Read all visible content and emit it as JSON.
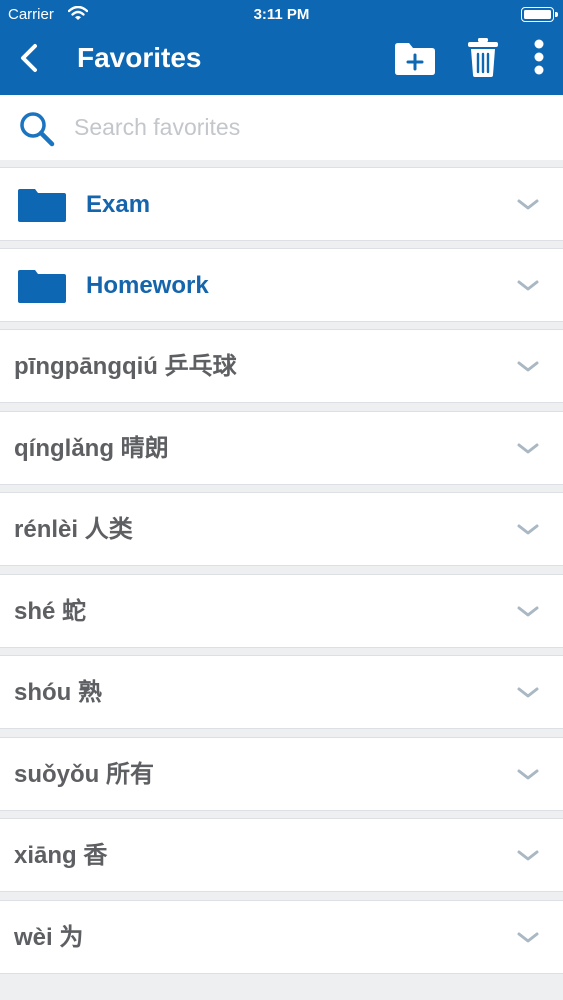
{
  "status_bar": {
    "carrier": "Carrier",
    "time": "3:11 PM"
  },
  "header": {
    "title": "Favorites"
  },
  "search": {
    "placeholder": "Search favorites"
  },
  "folders": [
    {
      "label": "Exam"
    },
    {
      "label": "Homework"
    }
  ],
  "words": [
    {
      "label": "pīngpāngqiú 乒乓球"
    },
    {
      "label": "qínglǎng 晴朗"
    },
    {
      "label": "rénlèi 人类"
    },
    {
      "label": "shé 蛇"
    },
    {
      "label": "shóu 熟"
    },
    {
      "label": "suǒyǒu 所有"
    },
    {
      "label": "xiāng 香"
    },
    {
      "label": "wèi 为"
    }
  ],
  "colors": {
    "header": "#0d67b2",
    "folder_text": "#1565ad",
    "word_text": "#5d5f62",
    "chevron": "#aab8c4",
    "background": "#eeeff1"
  },
  "icons": {
    "back": "chevron-left-icon",
    "new_folder": "folder-plus-icon",
    "delete": "trash-icon",
    "more": "more-vertical-icon",
    "search": "search-icon",
    "folder": "folder-icon",
    "expand": "chevron-down-icon"
  }
}
